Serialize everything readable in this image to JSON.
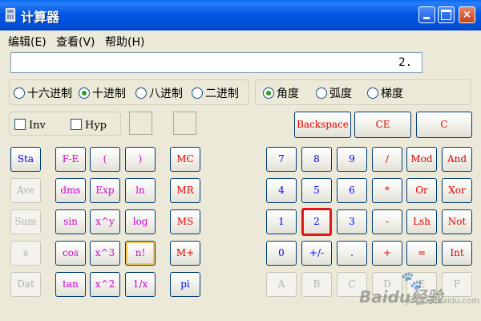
{
  "window": {
    "title": "计算器",
    "controls": {
      "minimize": "minimize",
      "maximize": "maximize",
      "close": "×"
    }
  },
  "menu": [
    "编辑(E)",
    "查看(V)",
    "帮助(H)"
  ],
  "display": {
    "value": "2."
  },
  "number_base": {
    "options": [
      "十六进制",
      "十进制",
      "八进制",
      "二进制"
    ],
    "selected": "十进制"
  },
  "angle_mode": {
    "options": [
      "角度",
      "弧度",
      "梯度"
    ],
    "selected": "角度"
  },
  "checkboxes": {
    "inv": "Inv",
    "hyp": "Hyp"
  },
  "edit_buttons": {
    "backspace": "Backspace",
    "ce": "CE",
    "c": "C"
  },
  "stat_buttons": [
    "Sta",
    "Ave",
    "Sum",
    "s",
    "Dat"
  ],
  "func_col1": [
    "F-E",
    "dms",
    "sin",
    "cos",
    "tan"
  ],
  "func_col2": [
    "(",
    "Exp",
    "x^y",
    "x^3",
    "x^2"
  ],
  "func_col3": [
    ")",
    "ln",
    "log",
    "n!",
    "1/x"
  ],
  "memory_buttons": [
    "MC",
    "MR",
    "MS",
    "M+",
    "pi"
  ],
  "keypad_rows": [
    [
      "7",
      "8",
      "9",
      "/",
      "Mod",
      "And"
    ],
    [
      "4",
      "5",
      "6",
      "*",
      "Or",
      "Xor"
    ],
    [
      "1",
      "2",
      "3",
      "-",
      "Lsh",
      "Not"
    ],
    [
      "0",
      "+/-",
      ".",
      "+",
      "=",
      "Int"
    ],
    [
      "A",
      "B",
      "C",
      "D",
      "E",
      "F"
    ]
  ],
  "watermark": {
    "brand": "Baidu经验",
    "url": "jingyan.baidu.com"
  },
  "colors": {
    "titlebar": "#0054e3",
    "accent_red": "#e20000",
    "accent_blue": "#0000ff",
    "accent_magenta": "#d000d0",
    "selection": "#e0161c"
  }
}
